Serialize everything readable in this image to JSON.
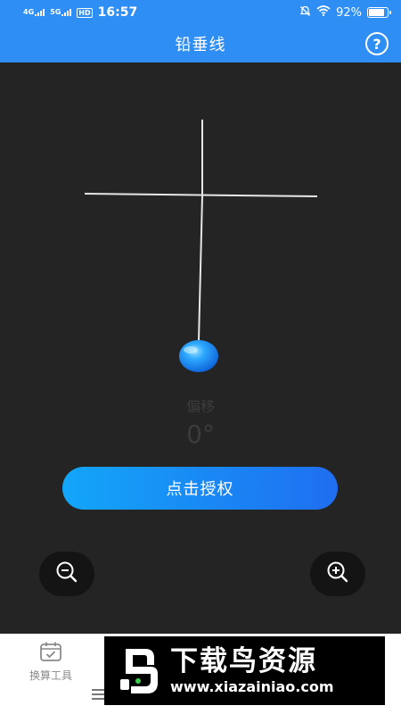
{
  "status_bar": {
    "net_1": "4G",
    "net_2": "5G",
    "hd": "HD",
    "time": "16:57",
    "battery": "92%",
    "battery_level": 0.92
  },
  "app_bar": {
    "title": "铅垂线",
    "help_icon": "help-icon",
    "help_label": "?"
  },
  "meter": {
    "offset_label": "偏移",
    "offset_value": "0°"
  },
  "actions": {
    "authorize_label": "点击授权"
  },
  "zoom": {
    "zoom_out_icon": "zoom-out-icon",
    "zoom_in_icon": "zoom-in-icon"
  },
  "bottom_nav": {
    "tool_label": "换算工具",
    "tool_icon": "calendar-check-icon",
    "menu_icon": "menu-icon"
  },
  "banner": {
    "title": "下载鸟资源",
    "url": "www.xiazainiao.com"
  },
  "colors": {
    "primary": "#2e8ef3",
    "background": "#242424",
    "button_start": "#13a6f9",
    "button_end": "#1f6ef0",
    "bob": "#1a8ef5"
  }
}
